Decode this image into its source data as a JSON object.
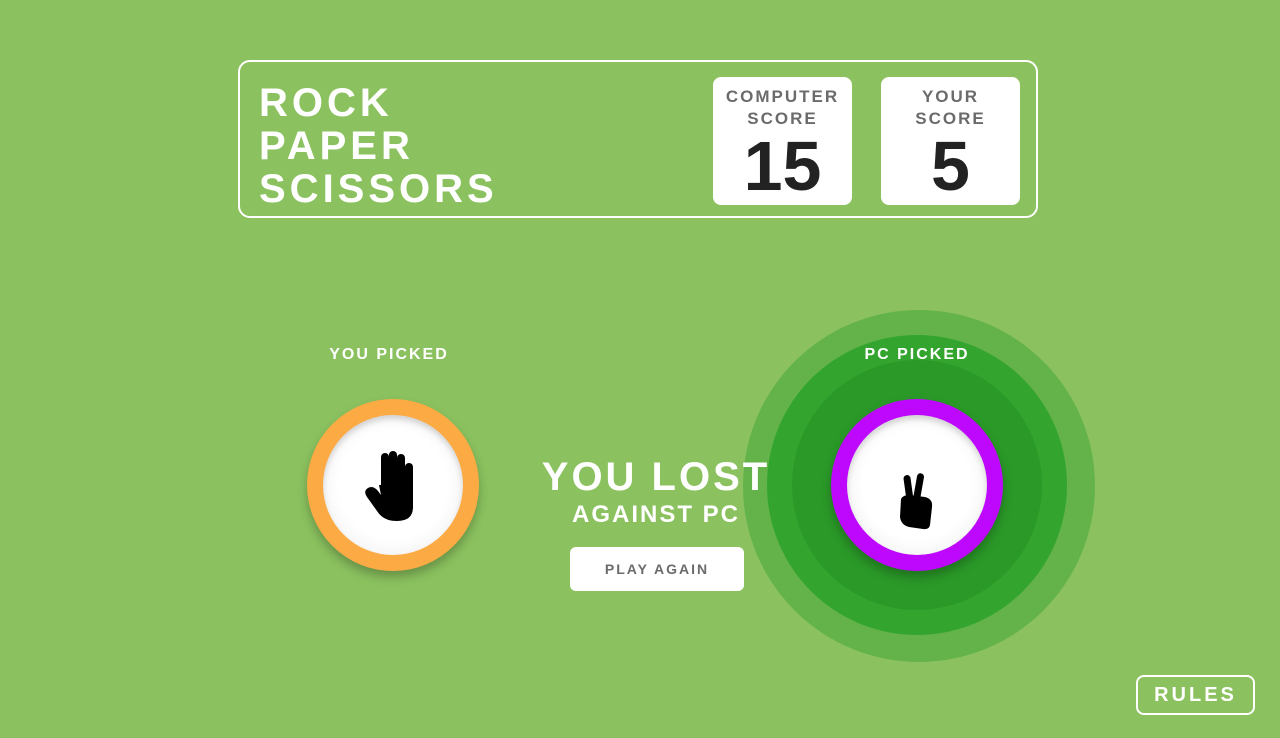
{
  "header": {
    "title_lines": [
      "ROCK",
      "PAPER",
      "SCISSORS"
    ],
    "computer_score": {
      "label_lines": [
        "COMPUTER",
        "SCORE"
      ],
      "value": "15"
    },
    "your_score": {
      "label_lines": [
        "YOUR",
        "SCORE"
      ],
      "value": "5"
    }
  },
  "game": {
    "you_picked_label": "YOU PICKED",
    "pc_picked_label": "PC PICKED",
    "you_choice": {
      "name": "paper",
      "icon": "open-hand-icon",
      "ring_color": "#fcab44"
    },
    "pc_choice": {
      "name": "scissors",
      "icon": "victory-hand-icon",
      "ring_color": "#bd08fd"
    },
    "winner": "pc",
    "halo_color": "#33a52e"
  },
  "result": {
    "main": "YOU LOST",
    "sub": "AGAINST PC",
    "play_again_label": "PLAY AGAIN"
  },
  "rules_label": "RULES",
  "colors": {
    "background": "#8bc25f",
    "text_light": "#ffffff",
    "score_text": "#222222",
    "label_text": "#6b6b6b"
  }
}
